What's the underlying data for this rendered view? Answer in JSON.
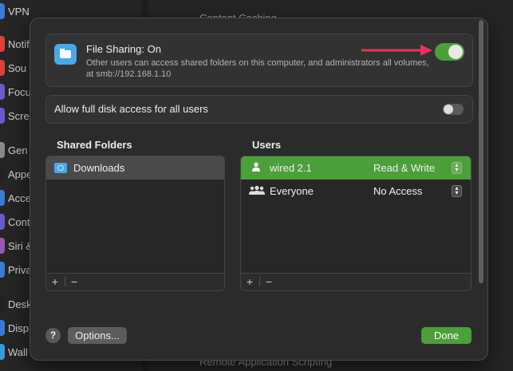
{
  "background": {
    "sidebar_items": [
      "VPN",
      "Notif",
      "Sou",
      "Focu",
      "Scre",
      "Gen",
      "Appe",
      "Acce",
      "Cont",
      "Siri &",
      "Priva",
      "Desk",
      "Disp",
      "Wall"
    ],
    "top_row": "Content Caching",
    "bottom_row": "Remote Application Scripting"
  },
  "file_sharing": {
    "title": "File Sharing: On",
    "description": "Other users can access shared folders on this computer, and administrators all volumes, at smb://192.168.1.10",
    "toggle_on": true
  },
  "full_disk_access": {
    "label": "Allow full disk access for all users",
    "toggle_on": false
  },
  "shared_folders": {
    "header": "Shared Folders",
    "items": [
      "Downloads"
    ],
    "add": "+",
    "remove": "−"
  },
  "users": {
    "header": "Users",
    "items": [
      {
        "name": "wired 2.1",
        "permission": "Read & Write",
        "icon": "person-icon",
        "selected": true
      },
      {
        "name": "Everyone",
        "permission": "No Access",
        "icon": "group-icon",
        "selected": false
      }
    ],
    "add": "+",
    "remove": "−"
  },
  "footer": {
    "help": "?",
    "options": "Options...",
    "done": "Done"
  },
  "colors": {
    "accent_green": "#4c9f3a",
    "folder_blue": "#4aa8e8",
    "arrow_red": "#e8345a"
  }
}
